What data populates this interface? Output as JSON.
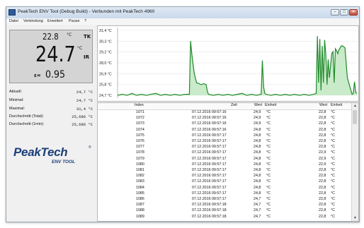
{
  "window": {
    "title": "PeakTech ENV Tool (Debug Build) - Verbunden mit PeakTech 4960",
    "buttons": {
      "minimize": "–",
      "maximize": "□",
      "close": "✕"
    }
  },
  "menu": [
    "Datei",
    "Verbindung",
    "Erweitert",
    "Pause",
    "?"
  ],
  "display": {
    "top_value": "22.8",
    "top_unit": "°C",
    "top_mode": "TK",
    "main_value": "24.7",
    "main_unit": "°C",
    "main_mode": "IR",
    "emissivity_label": "ε=",
    "emissivity_value": "0.95"
  },
  "stats": [
    {
      "label": "Aktuell:",
      "value": "24,7 °C"
    },
    {
      "label": "Minimal:",
      "value": "24,7 °C"
    },
    {
      "label": "Maximal:",
      "value": "31,4 °C"
    },
    {
      "label": "Durchschnitt (Total):",
      "value": "25,686 °C"
    },
    {
      "label": "Durchschnitt (1min):",
      "value": "25,686 °C"
    }
  ],
  "logo": {
    "main": "PeakTech",
    "reg": "®",
    "sub": "ENV TOOL"
  },
  "chart_data": {
    "type": "area",
    "ylim": [
      24.7,
      31.4
    ],
    "ytick_labels": [
      "31,4 °C",
      "30,3 °C",
      "29,2 °C",
      "28,0 °C",
      "26,9 °C",
      "25,8 °C",
      "24,7 °C"
    ],
    "grid": true,
    "color": "#1f8a2a",
    "fill_color": "#c9ebc9",
    "series": [
      {
        "x": [
          0,
          2,
          4,
          6,
          8,
          10,
          12,
          14,
          16,
          18,
          20,
          22,
          24,
          26,
          28,
          30,
          30.5,
          31,
          32,
          33,
          34,
          35,
          36,
          37,
          37.5,
          38,
          40,
          42,
          44,
          46,
          48,
          50,
          52,
          54,
          56,
          58,
          60,
          60.5,
          61,
          61.5,
          62,
          64,
          66,
          68,
          70,
          72,
          74,
          76,
          78,
          80,
          82,
          83,
          83.5,
          84,
          84.5,
          85,
          85.5,
          86,
          86.5,
          87,
          87.5,
          88,
          88.5,
          89,
          89.5,
          90,
          90.5,
          91,
          91.5,
          92,
          92.5,
          93,
          93.5,
          94,
          94.5,
          95,
          96,
          98,
          98.5,
          99,
          99.5,
          100
        ],
        "y": [
          24.7,
          24.8,
          24.7,
          24.9,
          24.7,
          24.8,
          24.7,
          24.8,
          24.9,
          24.7,
          24.8,
          24.7,
          24.8,
          24.7,
          24.8,
          24.8,
          30.3,
          29.0,
          27.0,
          26.0,
          25.9,
          25.8,
          25.9,
          25.8,
          25.1,
          24.8,
          24.7,
          24.8,
          24.7,
          24.8,
          24.7,
          24.8,
          24.9,
          24.7,
          24.8,
          24.7,
          24.8,
          28.3,
          25.6,
          24.9,
          24.8,
          24.7,
          24.8,
          24.7,
          24.8,
          24.7,
          24.8,
          24.7,
          24.8,
          24.7,
          24.8,
          24.9,
          30.8,
          26.0,
          30.5,
          25.2,
          29.8,
          26.0,
          30.4,
          28.9,
          25.8,
          28.4,
          26.5,
          27.8,
          29.0,
          29.2,
          26.0,
          29.5,
          29.3,
          29.0,
          29.4,
          29.6,
          29.8,
          29.8,
          29.7,
          29.6,
          26.5,
          24.8,
          24.9,
          26.1,
          25.0,
          24.9
        ]
      }
    ]
  },
  "table": {
    "columns": [
      "Index",
      "Zeit",
      "Wert",
      "Einheit",
      "Wert",
      "Einheit"
    ],
    "rows": [
      [
        "1071",
        "07.12.2016 09:57:16",
        "24,9",
        "°C",
        "22,8",
        "°C"
      ],
      [
        "1072",
        "07.12.2016 09:57:16",
        "24,9",
        "°C",
        "22,8",
        "°C"
      ],
      [
        "1073",
        "07.12.2016 09:57:16",
        "24,9",
        "°C",
        "22,8",
        "°C"
      ],
      [
        "1074",
        "07.12.2016 09:57:16",
        "24,8",
        "°C",
        "22,8",
        "°C"
      ],
      [
        "1075",
        "07.12.2016 09:57:17",
        "24,8",
        "°C",
        "22,8",
        "°C"
      ],
      [
        "1076",
        "07.12.2016 09:57:17",
        "24,8",
        "°C",
        "22,8",
        "°C"
      ],
      [
        "1077",
        "07.12.2016 09:57:17",
        "24,8",
        "°C",
        "22,8",
        "°C"
      ],
      [
        "1078",
        "07.12.2016 09:57:17",
        "24,8",
        "°C",
        "22,9",
        "°C"
      ],
      [
        "1079",
        "07.12.2016 09:57:17",
        "24,8",
        "°C",
        "22,9",
        "°C"
      ],
      [
        "1080",
        "07.12.2016 09:57:17",
        "24,8",
        "°C",
        "22,9",
        "°C"
      ],
      [
        "1081",
        "07.12.2016 09:57:17",
        "24,8",
        "°C",
        "22,8",
        "°C"
      ],
      [
        "1082",
        "07.12.2016 09:57:17",
        "24,8",
        "°C",
        "22,8",
        "°C"
      ],
      [
        "1083",
        "07.12.2016 09:57:17",
        "24,8",
        "°C",
        "22,8",
        "°C"
      ],
      [
        "1084",
        "07.12.2016 09:57:17",
        "24,8",
        "°C",
        "22,8",
        "°C"
      ],
      [
        "1085",
        "07.12.2016 09:57:17",
        "24,8",
        "°C",
        "22,8",
        "°C"
      ],
      [
        "1086",
        "07.12.2016 09:57:17",
        "24,7",
        "°C",
        "22,8",
        "°C"
      ],
      [
        "1087",
        "07.12.2016 09:57:18",
        "24,7",
        "°C",
        "22,8",
        "°C"
      ],
      [
        "1088",
        "07.12.2016 09:57:18",
        "24,7",
        "°C",
        "22,8",
        "°C"
      ],
      [
        "1089",
        "07.12.2016 09:57:18",
        "24,7",
        "°C",
        "22,8",
        "°C"
      ]
    ]
  },
  "scrollbar": {
    "up": "▲",
    "down": "▼"
  }
}
